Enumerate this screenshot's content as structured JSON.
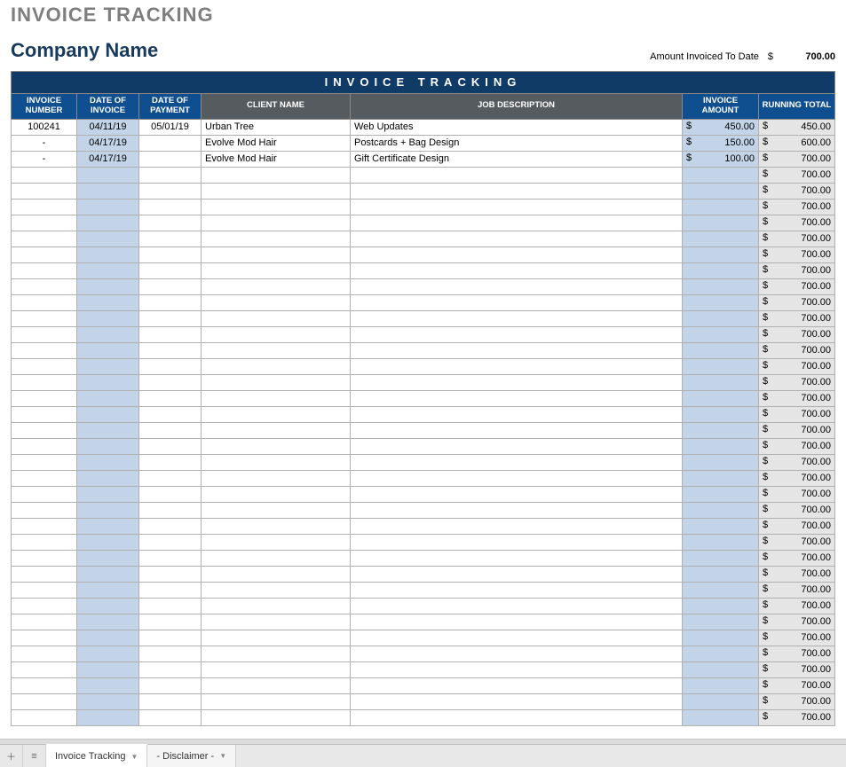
{
  "title": "INVOICE TRACKING",
  "company_name": "Company Name",
  "amount_label": "Amount Invoiced To Date",
  "currency_symbol": "$",
  "amount_to_date": "700.00",
  "banner": "INVOICE TRACKING",
  "columns": {
    "invoice_number": "INVOICE NUMBER",
    "date_of_invoice": "DATE OF INVOICE",
    "date_of_payment": "DATE OF PAYMENT",
    "client_name": "CLIENT NAME",
    "job_description": "JOB DESCRIPTION",
    "invoice_amount": "INVOICE AMOUNT",
    "running_total": "RUNNING TOTAL"
  },
  "rows": [
    {
      "num": "100241",
      "date": "04/11/19",
      "pay": "05/01/19",
      "client": "Urban Tree",
      "desc": "Web Updates",
      "amt": "450.00",
      "run": "450.00"
    },
    {
      "num": "-",
      "date": "04/17/19",
      "pay": "",
      "client": "Evolve Mod Hair",
      "desc": "Postcards + Bag Design",
      "amt": "150.00",
      "run": "600.00"
    },
    {
      "num": "-",
      "date": "04/17/19",
      "pay": "",
      "client": "Evolve Mod Hair",
      "desc": "Gift Certificate Design",
      "amt": "100.00",
      "run": "700.00"
    },
    {
      "num": "",
      "date": "",
      "pay": "",
      "client": "",
      "desc": "",
      "amt": "",
      "run": "700.00"
    },
    {
      "num": "",
      "date": "",
      "pay": "",
      "client": "",
      "desc": "",
      "amt": "",
      "run": "700.00"
    },
    {
      "num": "",
      "date": "",
      "pay": "",
      "client": "",
      "desc": "",
      "amt": "",
      "run": "700.00"
    },
    {
      "num": "",
      "date": "",
      "pay": "",
      "client": "",
      "desc": "",
      "amt": "",
      "run": "700.00"
    },
    {
      "num": "",
      "date": "",
      "pay": "",
      "client": "",
      "desc": "",
      "amt": "",
      "run": "700.00"
    },
    {
      "num": "",
      "date": "",
      "pay": "",
      "client": "",
      "desc": "",
      "amt": "",
      "run": "700.00"
    },
    {
      "num": "",
      "date": "",
      "pay": "",
      "client": "",
      "desc": "",
      "amt": "",
      "run": "700.00"
    },
    {
      "num": "",
      "date": "",
      "pay": "",
      "client": "",
      "desc": "",
      "amt": "",
      "run": "700.00"
    },
    {
      "num": "",
      "date": "",
      "pay": "",
      "client": "",
      "desc": "",
      "amt": "",
      "run": "700.00"
    },
    {
      "num": "",
      "date": "",
      "pay": "",
      "client": "",
      "desc": "",
      "amt": "",
      "run": "700.00"
    },
    {
      "num": "",
      "date": "",
      "pay": "",
      "client": "",
      "desc": "",
      "amt": "",
      "run": "700.00"
    },
    {
      "num": "",
      "date": "",
      "pay": "",
      "client": "",
      "desc": "",
      "amt": "",
      "run": "700.00"
    },
    {
      "num": "",
      "date": "",
      "pay": "",
      "client": "",
      "desc": "",
      "amt": "",
      "run": "700.00"
    },
    {
      "num": "",
      "date": "",
      "pay": "",
      "client": "",
      "desc": "",
      "amt": "",
      "run": "700.00"
    },
    {
      "num": "",
      "date": "",
      "pay": "",
      "client": "",
      "desc": "",
      "amt": "",
      "run": "700.00"
    },
    {
      "num": "",
      "date": "",
      "pay": "",
      "client": "",
      "desc": "",
      "amt": "",
      "run": "700.00"
    },
    {
      "num": "",
      "date": "",
      "pay": "",
      "client": "",
      "desc": "",
      "amt": "",
      "run": "700.00"
    },
    {
      "num": "",
      "date": "",
      "pay": "",
      "client": "",
      "desc": "",
      "amt": "",
      "run": "700.00"
    },
    {
      "num": "",
      "date": "",
      "pay": "",
      "client": "",
      "desc": "",
      "amt": "",
      "run": "700.00"
    },
    {
      "num": "",
      "date": "",
      "pay": "",
      "client": "",
      "desc": "",
      "amt": "",
      "run": "700.00"
    },
    {
      "num": "",
      "date": "",
      "pay": "",
      "client": "",
      "desc": "",
      "amt": "",
      "run": "700.00"
    },
    {
      "num": "",
      "date": "",
      "pay": "",
      "client": "",
      "desc": "",
      "amt": "",
      "run": "700.00"
    },
    {
      "num": "",
      "date": "",
      "pay": "",
      "client": "",
      "desc": "",
      "amt": "",
      "run": "700.00"
    },
    {
      "num": "",
      "date": "",
      "pay": "",
      "client": "",
      "desc": "",
      "amt": "",
      "run": "700.00"
    },
    {
      "num": "",
      "date": "",
      "pay": "",
      "client": "",
      "desc": "",
      "amt": "",
      "run": "700.00"
    },
    {
      "num": "",
      "date": "",
      "pay": "",
      "client": "",
      "desc": "",
      "amt": "",
      "run": "700.00"
    },
    {
      "num": "",
      "date": "",
      "pay": "",
      "client": "",
      "desc": "",
      "amt": "",
      "run": "700.00"
    },
    {
      "num": "",
      "date": "",
      "pay": "",
      "client": "",
      "desc": "",
      "amt": "",
      "run": "700.00"
    },
    {
      "num": "",
      "date": "",
      "pay": "",
      "client": "",
      "desc": "",
      "amt": "",
      "run": "700.00"
    },
    {
      "num": "",
      "date": "",
      "pay": "",
      "client": "",
      "desc": "",
      "amt": "",
      "run": "700.00"
    },
    {
      "num": "",
      "date": "",
      "pay": "",
      "client": "",
      "desc": "",
      "amt": "",
      "run": "700.00"
    },
    {
      "num": "",
      "date": "",
      "pay": "",
      "client": "",
      "desc": "",
      "amt": "",
      "run": "700.00"
    },
    {
      "num": "",
      "date": "",
      "pay": "",
      "client": "",
      "desc": "",
      "amt": "",
      "run": "700.00"
    },
    {
      "num": "",
      "date": "",
      "pay": "",
      "client": "",
      "desc": "",
      "amt": "",
      "run": "700.00"
    },
    {
      "num": "",
      "date": "",
      "pay": "",
      "client": "",
      "desc": "",
      "amt": "",
      "run": "700.00"
    }
  ],
  "tabs": [
    {
      "label": "Invoice Tracking",
      "active": true
    },
    {
      "label": "- Disclaimer -",
      "active": false
    }
  ]
}
